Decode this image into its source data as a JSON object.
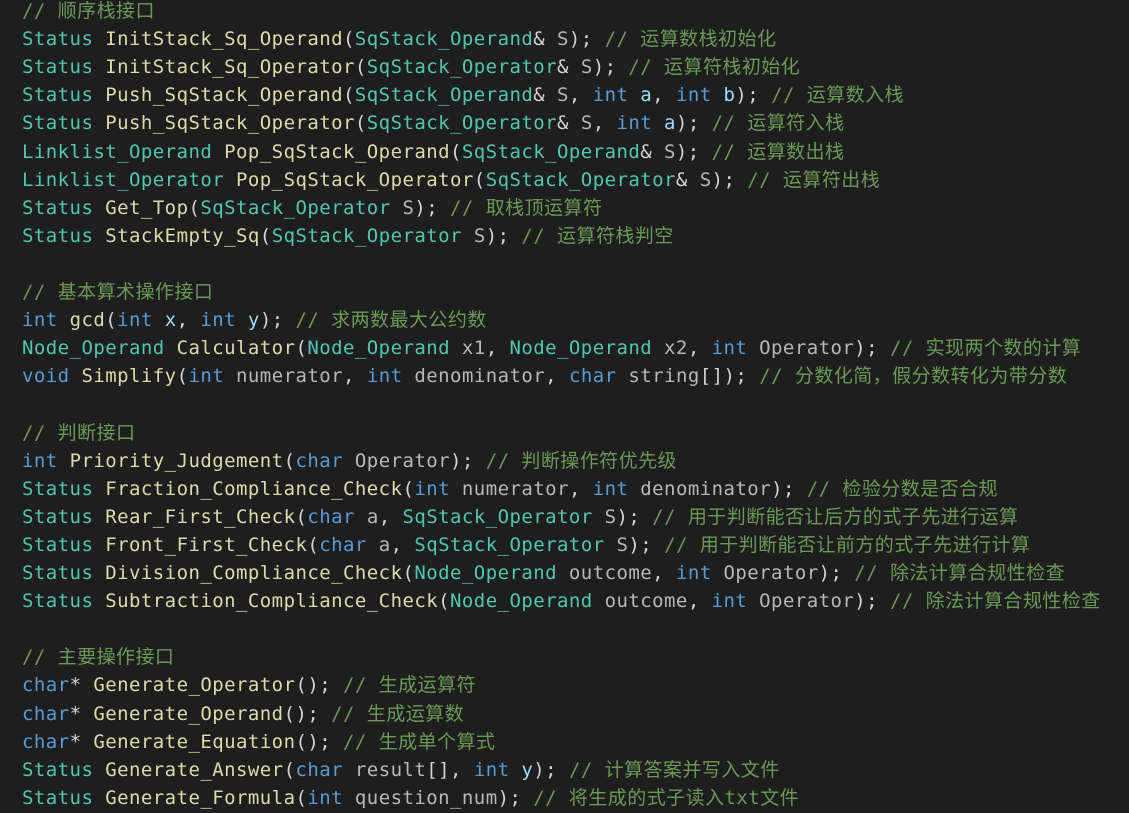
{
  "colors": {
    "background": "#1e1e1e",
    "type": "#4ec9b0",
    "keyword": "#569cd6",
    "function": "#dcdcaa",
    "comment": "#6a9955",
    "param": "#9cdcfe",
    "plain": "#d4d4d4"
  },
  "code_lines": [
    [
      [
        "cmt",
        "// 顺序栈接口"
      ]
    ],
    [
      [
        "type",
        "Status"
      ],
      [
        "plain",
        " "
      ],
      [
        "fn",
        "InitStack_Sq_Operand"
      ],
      [
        "plain",
        "("
      ],
      [
        "type",
        "SqStack_Operand"
      ],
      [
        "plain",
        "& "
      ],
      [
        "gray",
        "S"
      ],
      [
        "plain",
        "); "
      ],
      [
        "cmt",
        "// 运算数栈初始化"
      ]
    ],
    [
      [
        "type",
        "Status"
      ],
      [
        "plain",
        " "
      ],
      [
        "fn",
        "InitStack_Sq_Operator"
      ],
      [
        "plain",
        "("
      ],
      [
        "type",
        "SqStack_Operator"
      ],
      [
        "plain",
        "& "
      ],
      [
        "gray",
        "S"
      ],
      [
        "plain",
        "); "
      ],
      [
        "cmt",
        "// 运算符栈初始化"
      ]
    ],
    [
      [
        "type",
        "Status"
      ],
      [
        "plain",
        " "
      ],
      [
        "fn",
        "Push_SqStack_Operand"
      ],
      [
        "plain",
        "("
      ],
      [
        "type",
        "SqStack_Operand"
      ],
      [
        "plain",
        "& "
      ],
      [
        "gray",
        "S"
      ],
      [
        "plain",
        ", "
      ],
      [
        "kw",
        "int"
      ],
      [
        "plain",
        " "
      ],
      [
        "param",
        "a"
      ],
      [
        "plain",
        ", "
      ],
      [
        "kw",
        "int"
      ],
      [
        "plain",
        " "
      ],
      [
        "param",
        "b"
      ],
      [
        "plain",
        "); "
      ],
      [
        "cmt",
        "// 运算数入栈"
      ]
    ],
    [
      [
        "type",
        "Status"
      ],
      [
        "plain",
        " "
      ],
      [
        "fn",
        "Push_SqStack_Operator"
      ],
      [
        "plain",
        "("
      ],
      [
        "type",
        "SqStack_Operator"
      ],
      [
        "plain",
        "& "
      ],
      [
        "gray",
        "S"
      ],
      [
        "plain",
        ", "
      ],
      [
        "kw",
        "int"
      ],
      [
        "plain",
        " "
      ],
      [
        "param",
        "a"
      ],
      [
        "plain",
        "); "
      ],
      [
        "cmt",
        "// 运算符入栈"
      ]
    ],
    [
      [
        "type",
        "Linklist_Operand"
      ],
      [
        "plain",
        " "
      ],
      [
        "fn",
        "Pop_SqStack_Operand"
      ],
      [
        "plain",
        "("
      ],
      [
        "type",
        "SqStack_Operand"
      ],
      [
        "plain",
        "& "
      ],
      [
        "gray",
        "S"
      ],
      [
        "plain",
        "); "
      ],
      [
        "cmt",
        "// 运算数出栈"
      ]
    ],
    [
      [
        "type",
        "Linklist_Operator"
      ],
      [
        "plain",
        " "
      ],
      [
        "fn",
        "Pop_SqStack_Operator"
      ],
      [
        "plain",
        "("
      ],
      [
        "type",
        "SqStack_Operator"
      ],
      [
        "plain",
        "& "
      ],
      [
        "gray",
        "S"
      ],
      [
        "plain",
        "); "
      ],
      [
        "cmt",
        "// 运算符出栈"
      ]
    ],
    [
      [
        "type",
        "Status"
      ],
      [
        "plain",
        " "
      ],
      [
        "fn",
        "Get_Top"
      ],
      [
        "plain",
        "("
      ],
      [
        "type",
        "SqStack_Operator"
      ],
      [
        "plain",
        " "
      ],
      [
        "gray",
        "S"
      ],
      [
        "plain",
        "); "
      ],
      [
        "cmt",
        "// 取栈顶运算符"
      ]
    ],
    [
      [
        "type",
        "Status"
      ],
      [
        "plain",
        " "
      ],
      [
        "fn",
        "StackEmpty_Sq"
      ],
      [
        "plain",
        "("
      ],
      [
        "type",
        "SqStack_Operator"
      ],
      [
        "plain",
        " "
      ],
      [
        "gray",
        "S"
      ],
      [
        "plain",
        "); "
      ],
      [
        "cmt",
        "// 运算符栈判空"
      ]
    ],
    [],
    [
      [
        "cmt",
        "// 基本算术操作接口"
      ]
    ],
    [
      [
        "kw",
        "int"
      ],
      [
        "plain",
        " "
      ],
      [
        "fn",
        "gcd"
      ],
      [
        "plain",
        "("
      ],
      [
        "kw",
        "int"
      ],
      [
        "plain",
        " "
      ],
      [
        "param",
        "x"
      ],
      [
        "plain",
        ", "
      ],
      [
        "kw",
        "int"
      ],
      [
        "plain",
        " "
      ],
      [
        "param",
        "y"
      ],
      [
        "plain",
        "); "
      ],
      [
        "cmt",
        "// 求两数最大公约数"
      ]
    ],
    [
      [
        "type",
        "Node_Operand"
      ],
      [
        "plain",
        " "
      ],
      [
        "fn",
        "Calculator"
      ],
      [
        "plain",
        "("
      ],
      [
        "type",
        "Node_Operand"
      ],
      [
        "plain",
        " "
      ],
      [
        "gray",
        "x1"
      ],
      [
        "plain",
        ", "
      ],
      [
        "type",
        "Node_Operand"
      ],
      [
        "plain",
        " "
      ],
      [
        "gray",
        "x2"
      ],
      [
        "plain",
        ", "
      ],
      [
        "kw",
        "int"
      ],
      [
        "plain",
        " "
      ],
      [
        "gray",
        "Operator"
      ],
      [
        "plain",
        "); "
      ],
      [
        "cmt",
        "// 实现两个数的计算"
      ]
    ],
    [
      [
        "kw",
        "void"
      ],
      [
        "plain",
        " "
      ],
      [
        "fn",
        "Simplify"
      ],
      [
        "plain",
        "("
      ],
      [
        "kw",
        "int"
      ],
      [
        "plain",
        " "
      ],
      [
        "gray",
        "numerator"
      ],
      [
        "plain",
        ", "
      ],
      [
        "kw",
        "int"
      ],
      [
        "plain",
        " "
      ],
      [
        "gray",
        "denominator"
      ],
      [
        "plain",
        ", "
      ],
      [
        "kw",
        "char"
      ],
      [
        "plain",
        " "
      ],
      [
        "gray",
        "string"
      ],
      [
        "plain",
        "[]); "
      ],
      [
        "cmt",
        "// 分数化简，假分数转化为带分数"
      ]
    ],
    [],
    [
      [
        "cmt",
        "// 判断接口"
      ]
    ],
    [
      [
        "kw",
        "int"
      ],
      [
        "plain",
        " "
      ],
      [
        "fn",
        "Priority_Judgement"
      ],
      [
        "plain",
        "("
      ],
      [
        "kw",
        "char"
      ],
      [
        "plain",
        " "
      ],
      [
        "gray",
        "Operator"
      ],
      [
        "plain",
        "); "
      ],
      [
        "cmt",
        "// 判断操作符优先级"
      ]
    ],
    [
      [
        "type",
        "Status"
      ],
      [
        "plain",
        " "
      ],
      [
        "fn",
        "Fraction_Compliance_Check"
      ],
      [
        "plain",
        "("
      ],
      [
        "kw",
        "int"
      ],
      [
        "plain",
        " "
      ],
      [
        "gray",
        "numerator"
      ],
      [
        "plain",
        ", "
      ],
      [
        "kw",
        "int"
      ],
      [
        "plain",
        " "
      ],
      [
        "gray",
        "denominator"
      ],
      [
        "plain",
        "); "
      ],
      [
        "cmt",
        "// 检验分数是否合规"
      ]
    ],
    [
      [
        "type",
        "Status"
      ],
      [
        "plain",
        " "
      ],
      [
        "fn",
        "Rear_First_Check"
      ],
      [
        "plain",
        "("
      ],
      [
        "kw",
        "char"
      ],
      [
        "plain",
        " "
      ],
      [
        "gray",
        "a"
      ],
      [
        "plain",
        ", "
      ],
      [
        "type",
        "SqStack_Operator"
      ],
      [
        "plain",
        " "
      ],
      [
        "gray",
        "S"
      ],
      [
        "plain",
        "); "
      ],
      [
        "cmt",
        "// 用于判断能否让后方的式子先进行运算"
      ]
    ],
    [
      [
        "type",
        "Status"
      ],
      [
        "plain",
        " "
      ],
      [
        "fn",
        "Front_First_Check"
      ],
      [
        "plain",
        "("
      ],
      [
        "kw",
        "char"
      ],
      [
        "plain",
        " "
      ],
      [
        "gray",
        "a"
      ],
      [
        "plain",
        ", "
      ],
      [
        "type",
        "SqStack_Operator"
      ],
      [
        "plain",
        " "
      ],
      [
        "gray",
        "S"
      ],
      [
        "plain",
        "); "
      ],
      [
        "cmt",
        "// 用于判断能否让前方的式子先进行计算"
      ]
    ],
    [
      [
        "type",
        "Status"
      ],
      [
        "plain",
        " "
      ],
      [
        "fn",
        "Division_Compliance_Check"
      ],
      [
        "plain",
        "("
      ],
      [
        "type",
        "Node_Operand"
      ],
      [
        "plain",
        " "
      ],
      [
        "gray",
        "outcome"
      ],
      [
        "plain",
        ", "
      ],
      [
        "kw",
        "int"
      ],
      [
        "plain",
        " "
      ],
      [
        "gray",
        "Operator"
      ],
      [
        "plain",
        "); "
      ],
      [
        "cmt",
        "// 除法计算合规性检查"
      ]
    ],
    [
      [
        "type",
        "Status"
      ],
      [
        "plain",
        " "
      ],
      [
        "fn",
        "Subtraction_Compliance_Check"
      ],
      [
        "plain",
        "("
      ],
      [
        "type",
        "Node_Operand"
      ],
      [
        "plain",
        " "
      ],
      [
        "gray",
        "outcome"
      ],
      [
        "plain",
        ", "
      ],
      [
        "kw",
        "int"
      ],
      [
        "plain",
        " "
      ],
      [
        "gray",
        "Operator"
      ],
      [
        "plain",
        "); "
      ],
      [
        "cmt",
        "// 除法计算合规性检查"
      ]
    ],
    [],
    [
      [
        "cmt",
        "// 主要操作接口"
      ]
    ],
    [
      [
        "kw",
        "char"
      ],
      [
        "plain",
        "* "
      ],
      [
        "fn",
        "Generate_Operator"
      ],
      [
        "plain",
        "(); "
      ],
      [
        "cmt",
        "// 生成运算符"
      ]
    ],
    [
      [
        "kw",
        "char"
      ],
      [
        "plain",
        "* "
      ],
      [
        "fn",
        "Generate_Operand"
      ],
      [
        "plain",
        "(); "
      ],
      [
        "cmt",
        "// 生成运算数"
      ]
    ],
    [
      [
        "kw",
        "char"
      ],
      [
        "plain",
        "* "
      ],
      [
        "fn",
        "Generate_Equation"
      ],
      [
        "plain",
        "(); "
      ],
      [
        "cmt",
        "// 生成单个算式"
      ]
    ],
    [
      [
        "type",
        "Status"
      ],
      [
        "plain",
        " "
      ],
      [
        "fn",
        "Generate_Answer"
      ],
      [
        "plain",
        "("
      ],
      [
        "kw",
        "char"
      ],
      [
        "plain",
        " "
      ],
      [
        "gray",
        "result"
      ],
      [
        "plain",
        "[], "
      ],
      [
        "kw",
        "int"
      ],
      [
        "plain",
        " "
      ],
      [
        "param",
        "y"
      ],
      [
        "plain",
        "); "
      ],
      [
        "cmt",
        "// 计算答案并写入文件"
      ]
    ],
    [
      [
        "type",
        "Status"
      ],
      [
        "plain",
        " "
      ],
      [
        "fn",
        "Generate_Formula"
      ],
      [
        "plain",
        "("
      ],
      [
        "kw",
        "int"
      ],
      [
        "plain",
        " "
      ],
      [
        "gray",
        "question_num"
      ],
      [
        "plain",
        "); "
      ],
      [
        "cmt",
        "// 将生成的式子读入txt文件"
      ]
    ]
  ]
}
